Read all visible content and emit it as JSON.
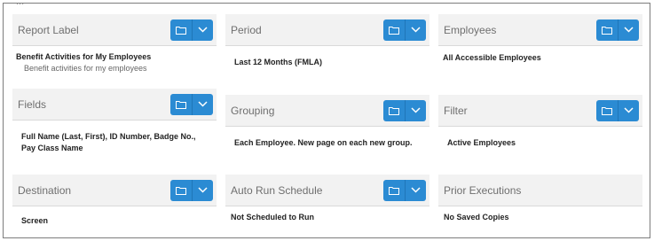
{
  "top_cut_text": "...",
  "cards": {
    "report_label": {
      "title": "Report Label",
      "value": "Benefit Activities for My Employees",
      "sub": "Benefit activities for my employees"
    },
    "period": {
      "title": "Period",
      "value": "Last 12 Months (FMLA)"
    },
    "employees": {
      "title": "Employees",
      "value": "All Accessible Employees"
    },
    "fields": {
      "title": "Fields",
      "value_line1": "Full Name (Last, First), ID Number, Badge No.,",
      "value_line2": "Pay Class Name"
    },
    "grouping": {
      "title": "Grouping",
      "value": "Each Employee. New page on each new group."
    },
    "filter": {
      "title": "Filter",
      "value": "Active Employees"
    },
    "destination": {
      "title": "Destination",
      "value": "Screen"
    },
    "auto_run": {
      "title": "Auto Run Schedule",
      "value": "Not Scheduled to Run"
    },
    "prior_exec": {
      "title": "Prior Executions",
      "value": "No Saved Copies"
    }
  },
  "colors": {
    "button": "#2b8bd3",
    "header_bg": "#f2f2f2",
    "title_text": "#6f6f6f"
  },
  "icons": {
    "folder": "folder-icon",
    "caret": "chevron-down-icon"
  }
}
